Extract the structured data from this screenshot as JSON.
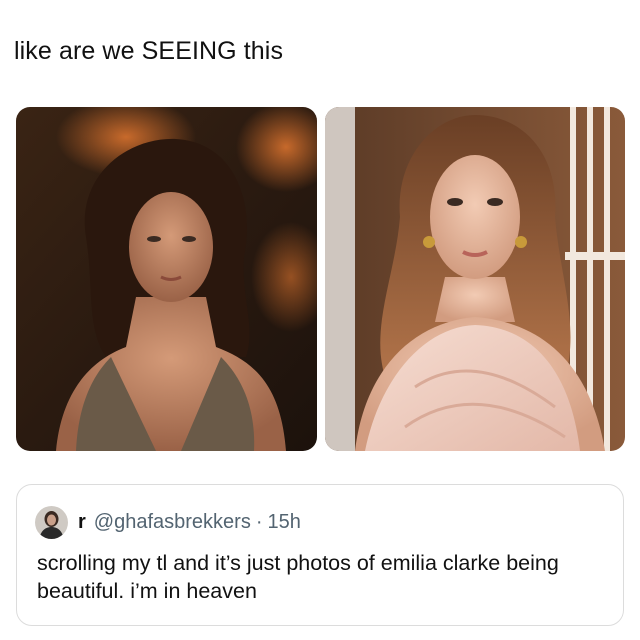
{
  "post": {
    "caption": "like are we SEEING this"
  },
  "photos": [
    {
      "icon": "photo-left-film-still"
    },
    {
      "icon": "photo-right-portrait"
    }
  ],
  "tweet": {
    "display_name": "r",
    "handle": "@ghafasbrekkers",
    "separator": "·",
    "time": "15h",
    "text": "scrolling my tl and it’s just photos of emilia clarke being beautiful. i’m in heaven"
  },
  "colors": {
    "text": "#111111",
    "secondary_text": "#536471",
    "card_border": "#dcdcdc",
    "background": "#ffffff"
  }
}
